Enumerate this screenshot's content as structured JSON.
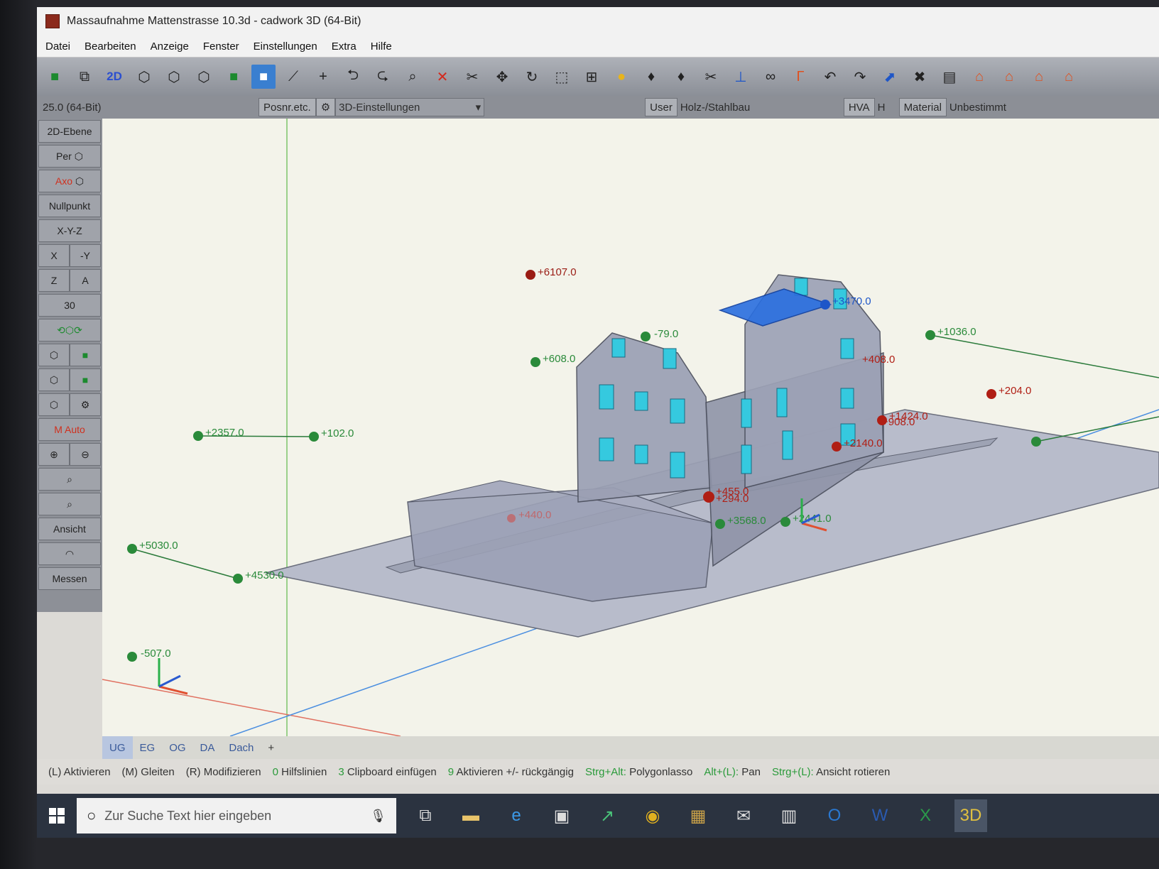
{
  "window": {
    "title": "Massaufnahme Mattenstrasse 10.3d - cadwork 3D (64-Bit)"
  },
  "menu": [
    "Datei",
    "Bearbeiten",
    "Anzeige",
    "Fenster",
    "Einstellungen",
    "Extra",
    "Hilfe"
  ],
  "toolbar": {
    "mode_2d": "2D"
  },
  "subbar": {
    "version": "25.0 (64-Bit)",
    "posnr": "Posnr.etc.",
    "view_settings": "3D-Einstellungen",
    "user": "User",
    "domain": "Holz-/Stahlbau",
    "hva": "HVA",
    "h": "H",
    "material": "Material",
    "material_value": "Unbestimmt"
  },
  "left_panel": {
    "ebene": "2D-Ebene",
    "per": "Per",
    "axo": "Axo",
    "nullpunkt": "Nullpunkt",
    "xyz": "X-Y-Z",
    "x": "X",
    "minus_y": "-Y",
    "z": "Z",
    "a": "A",
    "n30": "30",
    "m_auto": "M Auto",
    "ansicht": "Ansicht",
    "messen": "Messen"
  },
  "points": {
    "p6107": "+6107.0",
    "p79": "-79.0",
    "p608": "+608.0",
    "p2357": "+2357.0",
    "p102": "+102.0",
    "p5030": "+5030.0",
    "p4530": "+4530.0",
    "p507": "-507.0",
    "p1036": "+1036.0",
    "p204": "+204.0",
    "p3470": "+3470.0",
    "p1424": "+1424.0",
    "p908": "+908.0",
    "p2140": "+2140.0",
    "p455": "+455.0",
    "p294": "+294.0",
    "p3568": "+3568.0",
    "p2441": "+2441.0",
    "p440": "+440.0",
    "p408": "+408.0"
  },
  "level_tabs": [
    "UG",
    "EG",
    "OG",
    "DA",
    "Dach",
    "+"
  ],
  "status": {
    "l": "(L) Aktivieren",
    "m": "(M) Gleiten",
    "r": "(R) Modifizieren",
    "k0": "0",
    "hilfslinien": "Hilfslinien",
    "k3": "3",
    "clipboard": "Clipboard einfügen",
    "k9": "9",
    "aktivieren": "Aktivieren +/- rückgängig",
    "k_strg_alt": "Strg+Alt:",
    "polygon": "Polygonlasso",
    "k_alt": "Alt+(L):",
    "pan": "Pan",
    "k_strg": "Strg+(L):",
    "rotate": "Ansicht rotieren"
  },
  "taskbar": {
    "search_placeholder": "Zur Suche Text hier eingeben"
  }
}
